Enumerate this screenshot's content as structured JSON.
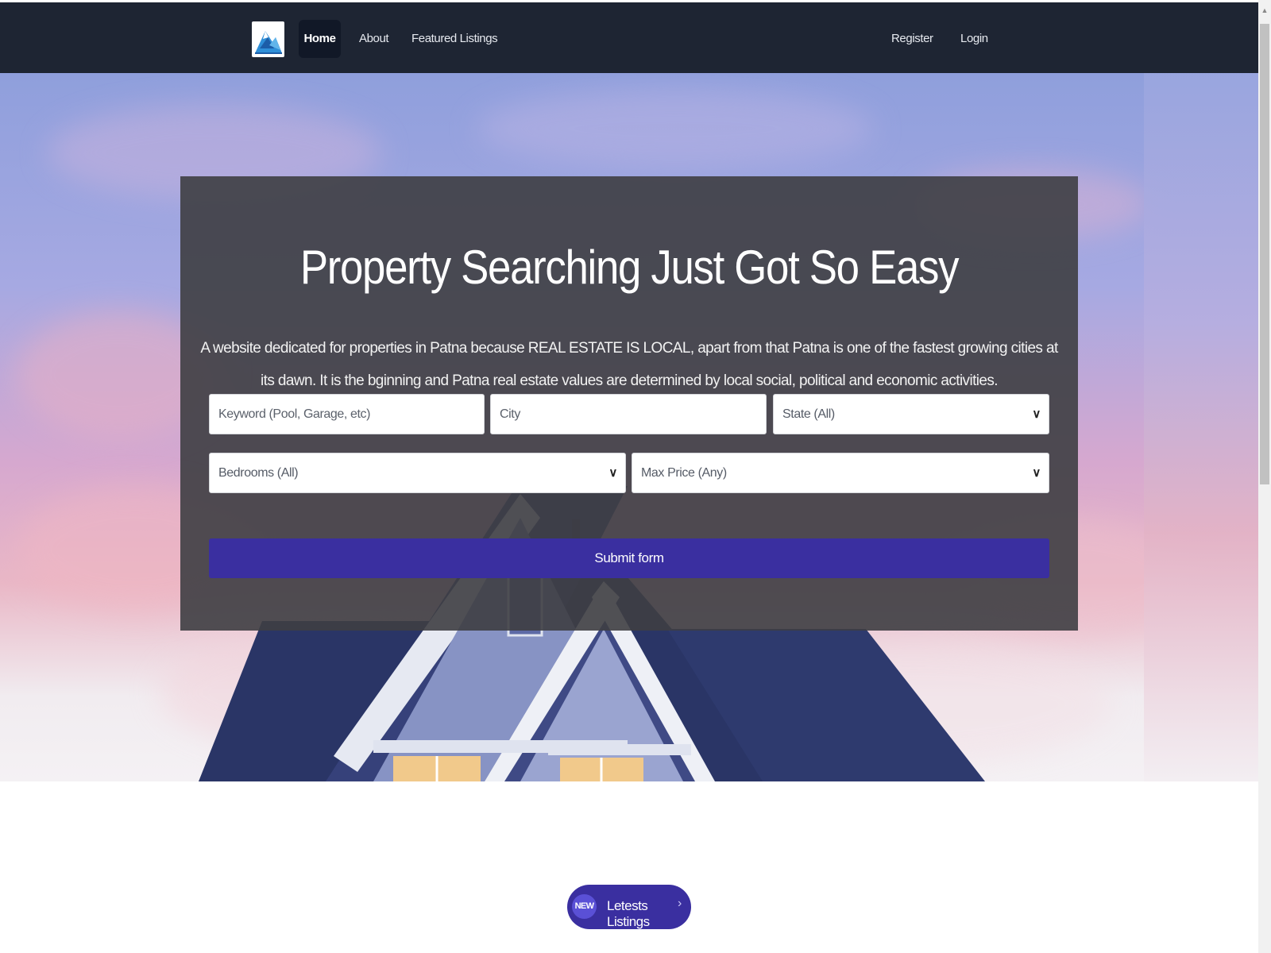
{
  "nav": {
    "logo_name": "mountain-logo",
    "home": "Home",
    "about": "About",
    "featured": "Featured Listings",
    "register": "Register",
    "login": "Login"
  },
  "hero": {
    "title": "Property Searching Just Got So Easy",
    "description": "A website dedicated for properties in Patna because REAL ESTATE IS LOCAL, apart from that Patna is one of the fastest growing cities at its dawn. It is the bginning and Patna real estate values are determined by local social, political and economic activities."
  },
  "search": {
    "keyword_placeholder": "Keyword (Pool, Garage, etc)",
    "city_placeholder": "City",
    "state_value": "State (All)",
    "bedrooms_value": "Bedrooms (All)",
    "price_value": "Max Price (Any)",
    "submit_label": "Submit form"
  },
  "latest": {
    "badge": "NEW",
    "label": "Letests Listings",
    "arrow": "›"
  },
  "colors": {
    "navbar": "#1e2533",
    "accent": "#3a2fa0",
    "card": "rgba(62,62,66,0.9)"
  }
}
